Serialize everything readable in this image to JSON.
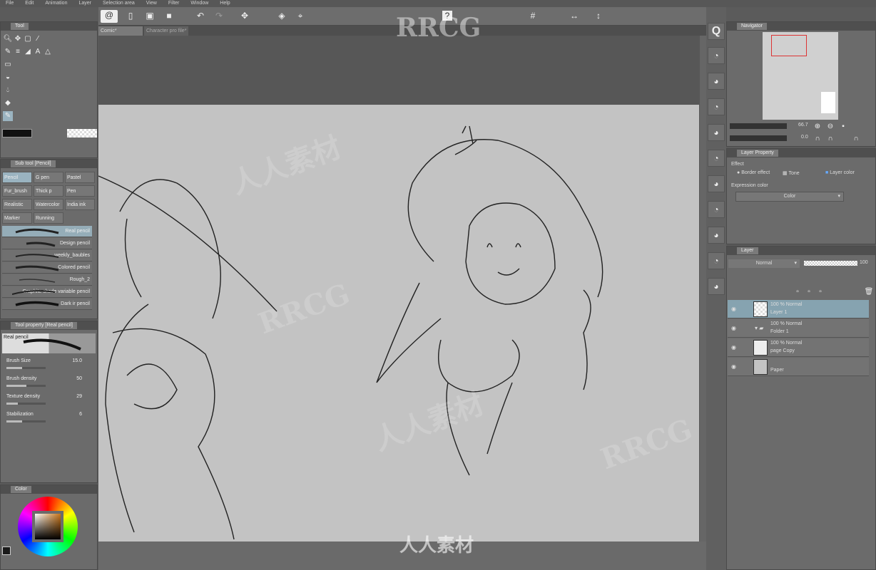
{
  "menu": [
    "File",
    "Edit",
    "Animation",
    "Layer",
    "Selection area",
    "View",
    "Filter",
    "Window",
    "Help"
  ],
  "tabs": [
    "Comic*",
    "Character pro file*"
  ],
  "tool_panel": {
    "title": "Tool"
  },
  "sub_tool": {
    "title": "Sub tool [Pencil]",
    "buttons": [
      "Pencil",
      "G pen",
      "Pastel",
      "Fur_brush",
      "Thick p",
      "Pen",
      "Realistic",
      "Watercolor",
      "India ink",
      "Marker",
      "Running"
    ],
    "brushes": [
      "Real pencil",
      "Design pencil",
      "weekly_baubles",
      "Colored pencil",
      "Rough_2",
      "Graphite shade variable pencil",
      "Dark ir pencil"
    ],
    "selected_brush": 0
  },
  "tool_property": {
    "title": "Tool property [Real pencil]",
    "brush_name": "Real pencil",
    "props": [
      {
        "label": "Brush Size",
        "value": "15.0",
        "level": 0.4
      },
      {
        "label": "Brush density",
        "value": "50",
        "level": 0.5
      },
      {
        "label": "Texture density",
        "value": "29",
        "level": 0.29
      },
      {
        "label": "Stabilization",
        "value": "6",
        "level": 0.4
      }
    ]
  },
  "color": {
    "title": "Color",
    "main": "#1a1a1a",
    "sub": "#ffffff"
  },
  "navigator": {
    "title": "Navigator",
    "zoom": "66.7",
    "rotation": "0.0"
  },
  "layer_property": {
    "title": "Layer Property",
    "effect_label": "Effect",
    "border_effect": "Border effect",
    "tone": "Tone",
    "layer_color": "Layer color",
    "expression_label": "Expression color",
    "expression_value": "Color"
  },
  "layers": {
    "title": "Layer",
    "blend": "Normal",
    "opacity": "100",
    "items": [
      {
        "mode": "100 % Normal",
        "name": "Layer 1",
        "selected": true
      },
      {
        "mode": "100 % Normal",
        "name": "Folder 1",
        "selected": false
      },
      {
        "mode": "100 % Normal",
        "name": "page Copy",
        "selected": false
      },
      {
        "mode": "",
        "name": "Paper",
        "selected": false
      }
    ]
  },
  "watermarks": [
    "RRCG",
    "人人素材"
  ]
}
